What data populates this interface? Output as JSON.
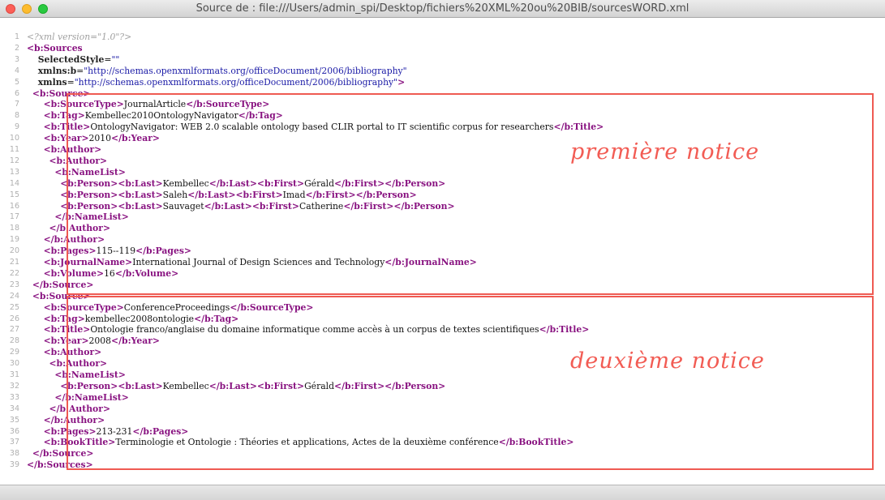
{
  "window": {
    "title": "Source de : file:///Users/admin_spi/Desktop/fichiers%20XML%20ou%20BIB/sourcesWORD.xml"
  },
  "annotations": {
    "first": "première notice",
    "second": "deuxième notice"
  },
  "colors": {
    "annotation": "#ef5a52",
    "tag": "#881280",
    "attribute_value": "#1a1aa6",
    "line_number": "#b0b0b0"
  },
  "lines": [
    {
      "n": "1",
      "indent": "",
      "segs": [
        {
          "c": "pi",
          "t": "<?xml version=\"1.0\"?>"
        }
      ]
    },
    {
      "n": "2",
      "indent": "",
      "segs": [
        {
          "c": "t",
          "t": "<b:Sources"
        }
      ]
    },
    {
      "n": "3",
      "indent": "    ",
      "segs": [
        {
          "c": "an",
          "t": "SelectedStyle"
        },
        {
          "c": "txt",
          "t": "="
        },
        {
          "c": "av",
          "t": "\"\""
        }
      ]
    },
    {
      "n": "4",
      "indent": "    ",
      "segs": [
        {
          "c": "an",
          "t": "xmlns:b"
        },
        {
          "c": "txt",
          "t": "="
        },
        {
          "c": "av",
          "t": "\"http://schemas.openxmlformats.org/officeDocument/2006/bibliography\""
        }
      ]
    },
    {
      "n": "5",
      "indent": "    ",
      "segs": [
        {
          "c": "an",
          "t": "xmlns"
        },
        {
          "c": "txt",
          "t": "="
        },
        {
          "c": "av",
          "t": "\"http://schemas.openxmlformats.org/officeDocument/2006/bibliography\""
        },
        {
          "c": "t",
          "t": ">"
        }
      ]
    },
    {
      "n": "6",
      "indent": "  ",
      "segs": [
        {
          "c": "t",
          "t": "<b:Source>"
        }
      ]
    },
    {
      "n": "7",
      "indent": "      ",
      "segs": [
        {
          "c": "t",
          "t": "<b:SourceType>"
        },
        {
          "c": "txt",
          "t": "JournalArticle"
        },
        {
          "c": "t",
          "t": "</b:SourceType>"
        }
      ]
    },
    {
      "n": "8",
      "indent": "      ",
      "segs": [
        {
          "c": "t",
          "t": "<b:Tag>"
        },
        {
          "c": "txt",
          "t": "Kembellec2010OntologyNavigator"
        },
        {
          "c": "t",
          "t": "</b:Tag>"
        }
      ]
    },
    {
      "n": "9",
      "indent": "      ",
      "segs": [
        {
          "c": "t",
          "t": "<b:Title>"
        },
        {
          "c": "txt",
          "t": "OntologyNavigator: WEB 2.0 scalable ontology based CLIR portal to IT scientific corpus for researchers"
        },
        {
          "c": "t",
          "t": "</b:Title>"
        }
      ]
    },
    {
      "n": "10",
      "indent": "      ",
      "segs": [
        {
          "c": "t",
          "t": "<b:Year>"
        },
        {
          "c": "txt",
          "t": "2010"
        },
        {
          "c": "t",
          "t": "</b:Year>"
        }
      ]
    },
    {
      "n": "11",
      "indent": "      ",
      "segs": [
        {
          "c": "t",
          "t": "<b:Author>"
        }
      ]
    },
    {
      "n": "12",
      "indent": "        ",
      "segs": [
        {
          "c": "t",
          "t": "<b:Author>"
        }
      ]
    },
    {
      "n": "13",
      "indent": "          ",
      "segs": [
        {
          "c": "t",
          "t": "<b:NameList>"
        }
      ]
    },
    {
      "n": "14",
      "indent": "            ",
      "segs": [
        {
          "c": "t",
          "t": "<b:Person><b:Last>"
        },
        {
          "c": "txt",
          "t": "Kembellec"
        },
        {
          "c": "t",
          "t": "</b:Last><b:First>"
        },
        {
          "c": "txt",
          "t": "Gérald"
        },
        {
          "c": "t",
          "t": "</b:First></b:Person>"
        }
      ]
    },
    {
      "n": "15",
      "indent": "            ",
      "segs": [
        {
          "c": "t",
          "t": "<b:Person><b:Last>"
        },
        {
          "c": "txt",
          "t": "Saleh"
        },
        {
          "c": "t",
          "t": "</b:Last><b:First>"
        },
        {
          "c": "txt",
          "t": "Imad"
        },
        {
          "c": "t",
          "t": "</b:First></b:Person>"
        }
      ]
    },
    {
      "n": "16",
      "indent": "            ",
      "segs": [
        {
          "c": "t",
          "t": "<b:Person><b:Last>"
        },
        {
          "c": "txt",
          "t": "Sauvaget"
        },
        {
          "c": "t",
          "t": "</b:Last><b:First>"
        },
        {
          "c": "txt",
          "t": "Catherine"
        },
        {
          "c": "t",
          "t": "</b:First></b:Person>"
        }
      ]
    },
    {
      "n": "17",
      "indent": "          ",
      "segs": [
        {
          "c": "t",
          "t": "</b:NameList>"
        }
      ]
    },
    {
      "n": "18",
      "indent": "        ",
      "segs": [
        {
          "c": "t",
          "t": "</b:Author>"
        }
      ]
    },
    {
      "n": "19",
      "indent": "      ",
      "segs": [
        {
          "c": "t",
          "t": "</b:Author>"
        }
      ]
    },
    {
      "n": "20",
      "indent": "      ",
      "segs": [
        {
          "c": "t",
          "t": "<b:Pages>"
        },
        {
          "c": "txt",
          "t": "115--119"
        },
        {
          "c": "t",
          "t": "</b:Pages>"
        }
      ]
    },
    {
      "n": "21",
      "indent": "      ",
      "segs": [
        {
          "c": "t",
          "t": "<b:JournalName>"
        },
        {
          "c": "txt",
          "t": "International Journal of Design Sciences and Technology"
        },
        {
          "c": "t",
          "t": "</b:JournalName>"
        }
      ]
    },
    {
      "n": "22",
      "indent": "      ",
      "segs": [
        {
          "c": "t",
          "t": "<b:Volume>"
        },
        {
          "c": "txt",
          "t": "16"
        },
        {
          "c": "t",
          "t": "</b:Volume>"
        }
      ]
    },
    {
      "n": "23",
      "indent": "  ",
      "segs": [
        {
          "c": "t",
          "t": "</b:Source>"
        }
      ]
    },
    {
      "n": "24",
      "indent": "  ",
      "segs": [
        {
          "c": "t",
          "t": "<b:Source>"
        }
      ]
    },
    {
      "n": "25",
      "indent": "      ",
      "segs": [
        {
          "c": "t",
          "t": "<b:SourceType>"
        },
        {
          "c": "txt",
          "t": "ConferenceProceedings"
        },
        {
          "c": "t",
          "t": "</b:SourceType>"
        }
      ]
    },
    {
      "n": "26",
      "indent": "      ",
      "segs": [
        {
          "c": "t",
          "t": "<b:Tag>"
        },
        {
          "c": "txt",
          "t": "kembellec2008ontologie"
        },
        {
          "c": "t",
          "t": "</b:Tag>"
        }
      ]
    },
    {
      "n": "27",
      "indent": "      ",
      "segs": [
        {
          "c": "t",
          "t": "<b:Title>"
        },
        {
          "c": "txt",
          "t": "Ontologie franco/anglaise du domaine informatique comme accès à un corpus de textes scientifiques"
        },
        {
          "c": "t",
          "t": "</b:Title>"
        }
      ]
    },
    {
      "n": "28",
      "indent": "      ",
      "segs": [
        {
          "c": "t",
          "t": "<b:Year>"
        },
        {
          "c": "txt",
          "t": "2008"
        },
        {
          "c": "t",
          "t": "</b:Year>"
        }
      ]
    },
    {
      "n": "29",
      "indent": "      ",
      "segs": [
        {
          "c": "t",
          "t": "<b:Author>"
        }
      ]
    },
    {
      "n": "30",
      "indent": "        ",
      "segs": [
        {
          "c": "t",
          "t": "<b:Author>"
        }
      ]
    },
    {
      "n": "31",
      "indent": "          ",
      "segs": [
        {
          "c": "t",
          "t": "<b:NameList>"
        }
      ]
    },
    {
      "n": "32",
      "indent": "            ",
      "segs": [
        {
          "c": "t",
          "t": "<b:Person><b:Last>"
        },
        {
          "c": "txt",
          "t": "Kembellec"
        },
        {
          "c": "t",
          "t": "</b:Last><b:First>"
        },
        {
          "c": "txt",
          "t": "Gérald"
        },
        {
          "c": "t",
          "t": "</b:First></b:Person>"
        }
      ]
    },
    {
      "n": "33",
      "indent": "          ",
      "segs": [
        {
          "c": "t",
          "t": "</b:NameList>"
        }
      ]
    },
    {
      "n": "34",
      "indent": "        ",
      "segs": [
        {
          "c": "t",
          "t": "</b:Author>"
        }
      ]
    },
    {
      "n": "35",
      "indent": "      ",
      "segs": [
        {
          "c": "t",
          "t": "</b:Author>"
        }
      ]
    },
    {
      "n": "36",
      "indent": "      ",
      "segs": [
        {
          "c": "t",
          "t": "<b:Pages>"
        },
        {
          "c": "txt",
          "t": "213-231"
        },
        {
          "c": "t",
          "t": "</b:Pages>"
        }
      ]
    },
    {
      "n": "37",
      "indent": "      ",
      "segs": [
        {
          "c": "t",
          "t": "<b:BookTitle>"
        },
        {
          "c": "txt",
          "t": "Terminologie et Ontologie : Théories et applications, Actes de la deuxième conférence"
        },
        {
          "c": "t",
          "t": "</b:BookTitle>"
        }
      ]
    },
    {
      "n": "38",
      "indent": "  ",
      "segs": [
        {
          "c": "t",
          "t": "</b:Source>"
        }
      ]
    },
    {
      "n": "39",
      "indent": "",
      "segs": [
        {
          "c": "t",
          "t": "</b:Sources>"
        }
      ]
    }
  ]
}
